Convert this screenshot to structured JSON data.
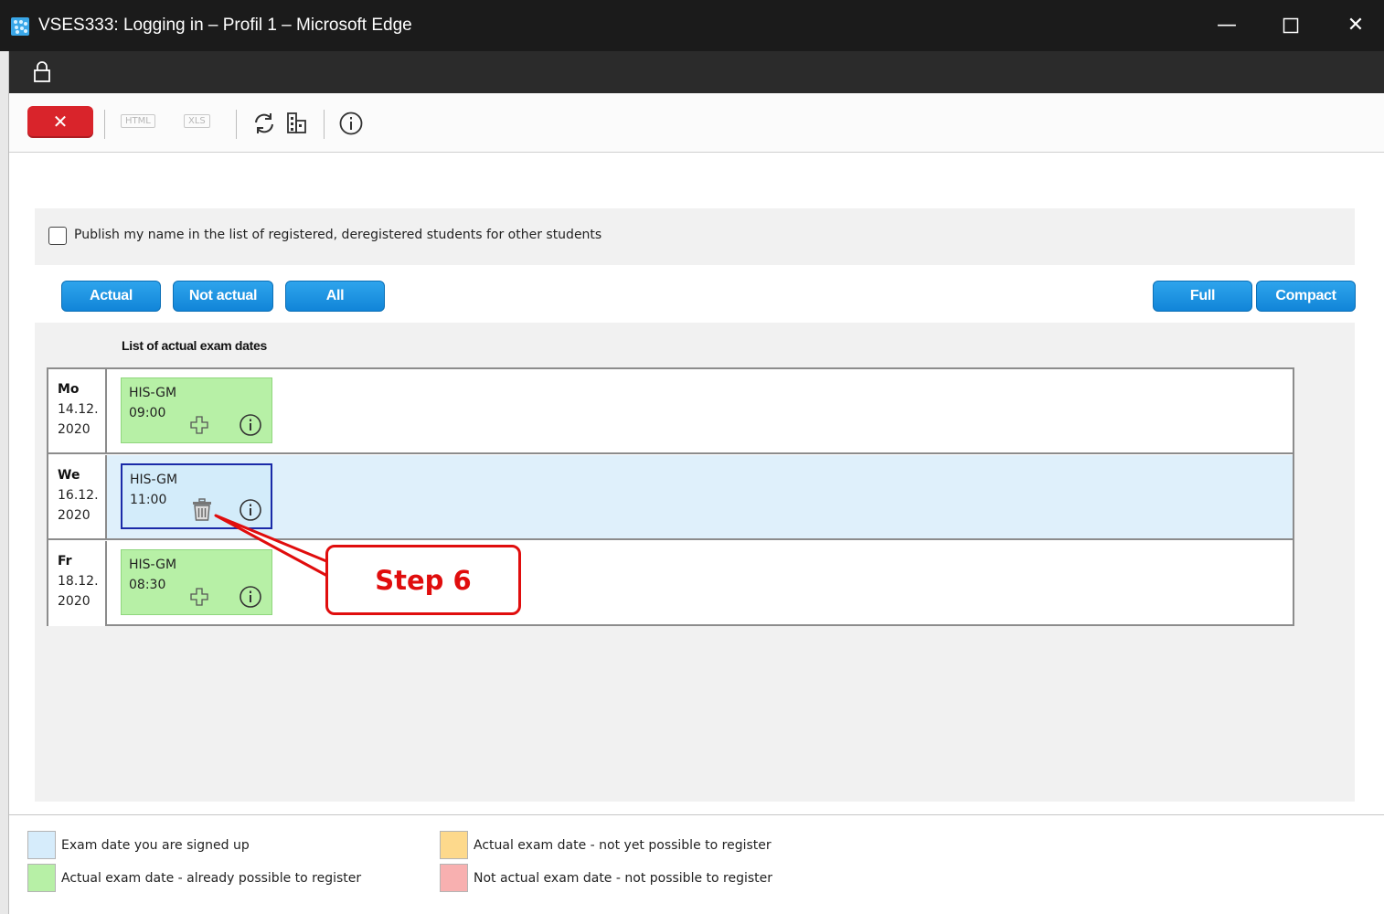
{
  "window": {
    "title": "VSES333: Logging in – Profil 1 – Microsoft Edge",
    "minimize_glyph": "—",
    "maximize_glyph": "☐",
    "close_glyph": "✕"
  },
  "toolbar": {
    "close_glyph": "✕",
    "html_label": "HTML",
    "xls_label": "XLS",
    "icons": [
      "refresh-icon",
      "building-icon",
      "info-icon"
    ]
  },
  "publish": {
    "label": "Publish my name in the list of registered, deregistered students for other students",
    "checked": false
  },
  "filters": {
    "actual": "Actual",
    "not_actual": "Not actual",
    "all": "All",
    "full": "Full",
    "compact": "Compact"
  },
  "list": {
    "title": "List of actual exam dates",
    "rows": [
      {
        "day": "Mo",
        "date": "14.12.",
        "year": "2020",
        "code": "HIS-GM",
        "time": "09:00",
        "status": "can-register",
        "action_icon": "plus-icon"
      },
      {
        "day": "We",
        "date": "16.12.",
        "year": "2020",
        "code": "HIS-GM",
        "time": "11:00",
        "status": "signed-up",
        "action_icon": "trash-icon"
      },
      {
        "day": "Fr",
        "date": "18.12.",
        "year": "2020",
        "code": "HIS-GM",
        "time": "08:30",
        "status": "can-register",
        "action_icon": "plus-icon"
      }
    ]
  },
  "callout": {
    "label": "Step 6"
  },
  "legend": [
    {
      "label": "Exam date you are signed up",
      "color": "#d6ecfb"
    },
    {
      "label": "Actual exam date - already possible to register",
      "color": "#b7f0a6"
    },
    {
      "label": "Actual exam date - not yet possible to register",
      "color": "#fdd98c"
    },
    {
      "label": "Not actual exam date - not possible to register",
      "color": "#f8b0b0"
    }
  ],
  "colors": {
    "close_button": "#d9242b",
    "filter_button": "#1a95e3",
    "callout": "#e00d0d",
    "selected_border": "#1a2aa8"
  }
}
